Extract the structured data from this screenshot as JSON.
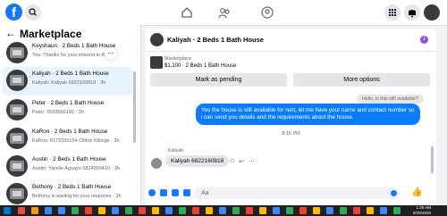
{
  "topbar": {
    "logo_text": "f"
  },
  "sidebar": {
    "title": "Marketplace",
    "back_glyph": "←",
    "conversations": [
      {
        "name": "Keyshaun · 2 Beds 1 Bath House",
        "subtitle": "You: Thanks for your interest in th..."
      },
      {
        "name": "Kaliyah · 2 Beds 1 Bath House",
        "subtitle": "Kaliyah: Kaliyah 6822160818 · 3h"
      },
      {
        "name": "Peter · 2 Beds 1 Bath House",
        "subtitle": "Peter: 5593560190 · 3h"
      },
      {
        "name": "KaRon · 2 Beds 1 Bath House",
        "subtitle": "KaRon: 8172335154 Clifton Killings · 3h"
      },
      {
        "name": "Austin · 2 Beds 1 Bath House",
        "subtitle": "Austin: Yarelie Aguayo 6824300410 · 3h"
      },
      {
        "name": "Bethony · 2 Beds 1 Bath House",
        "subtitle": "Bethony is waiting for your response · 3h"
      }
    ]
  },
  "chat": {
    "title": "Kaliyah · 2 Beds 1 Bath House",
    "info_glyph": "i",
    "listing_label": "Marketplace",
    "listing_price": "$1,100 · 2 Beds 1 Bath House",
    "mark_pending_label": "Mark as pending",
    "more_options_label": "More options",
    "grey_message": "Hello, is this still available?",
    "outgoing_message": "Yes the house is still available for rent, let me have your name and  contact number so i can send you details and the requirements about the house.",
    "timestamp": "8:15 PM",
    "sender_name": "Kaliyah",
    "incoming_message": "Kaliyah 6822160818",
    "composer_placeholder": "Aa",
    "like_glyph": "👍"
  },
  "taskbar": {
    "time": "1:25 AM",
    "date": "9/29/2025"
  },
  "colors": {
    "accent": "#1877f2",
    "outgoing": "#0a7cff",
    "info": "#9b51e0"
  }
}
